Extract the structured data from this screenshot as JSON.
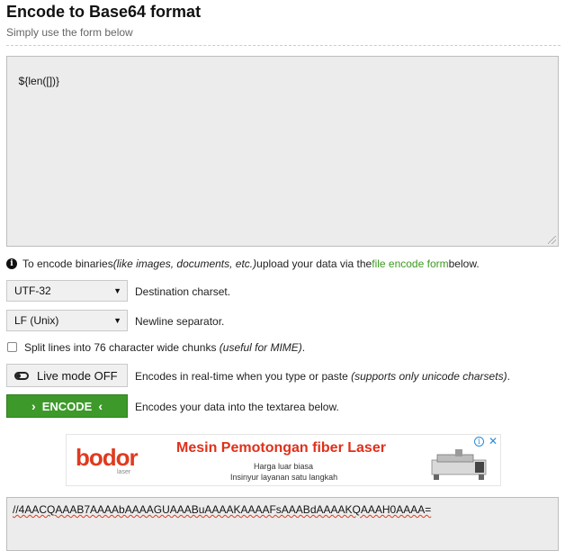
{
  "header": {
    "title": "Encode to Base64 format",
    "subtitle": "Simply use the form below"
  },
  "input": {
    "value": "${len([])}"
  },
  "info": {
    "prefix": "To encode binaries ",
    "italic": "(like images, documents, etc.)",
    "middle": " upload your data via the ",
    "link": "file encode form",
    "suffix": " below."
  },
  "charset": {
    "value": "UTF-32",
    "label": "Destination charset."
  },
  "newline": {
    "value": "LF (Unix)",
    "label": "Newline separator."
  },
  "split": {
    "label": "Split lines into 76 character wide chunks ",
    "note": "(useful for MIME)",
    "period": ".",
    "checked": false
  },
  "live_mode": {
    "button_label": "Live mode OFF",
    "desc": "Encodes in real-time when you type or paste ",
    "note": "(supports only unicode charsets)",
    "period": "."
  },
  "encode": {
    "button_label": "ENCODE",
    "desc": "Encodes your data into the textarea below."
  },
  "ad": {
    "brand": "bodor",
    "brand_sub": "laser",
    "headline": "Mesin Pemotongan fiber Laser",
    "line1": "Harga luar biasa",
    "line2": "Insinyur layanan satu langkah"
  },
  "output": {
    "value": "//4AACQAAAB7AAAAbAAAAGUAAABuAAAAKAAAAFsAAABdAAAAKQAAAH0AAAA="
  },
  "colors": {
    "accent_green": "#3d9a2a",
    "link_green": "#3c9a1e",
    "ad_red": "#e0301a"
  }
}
